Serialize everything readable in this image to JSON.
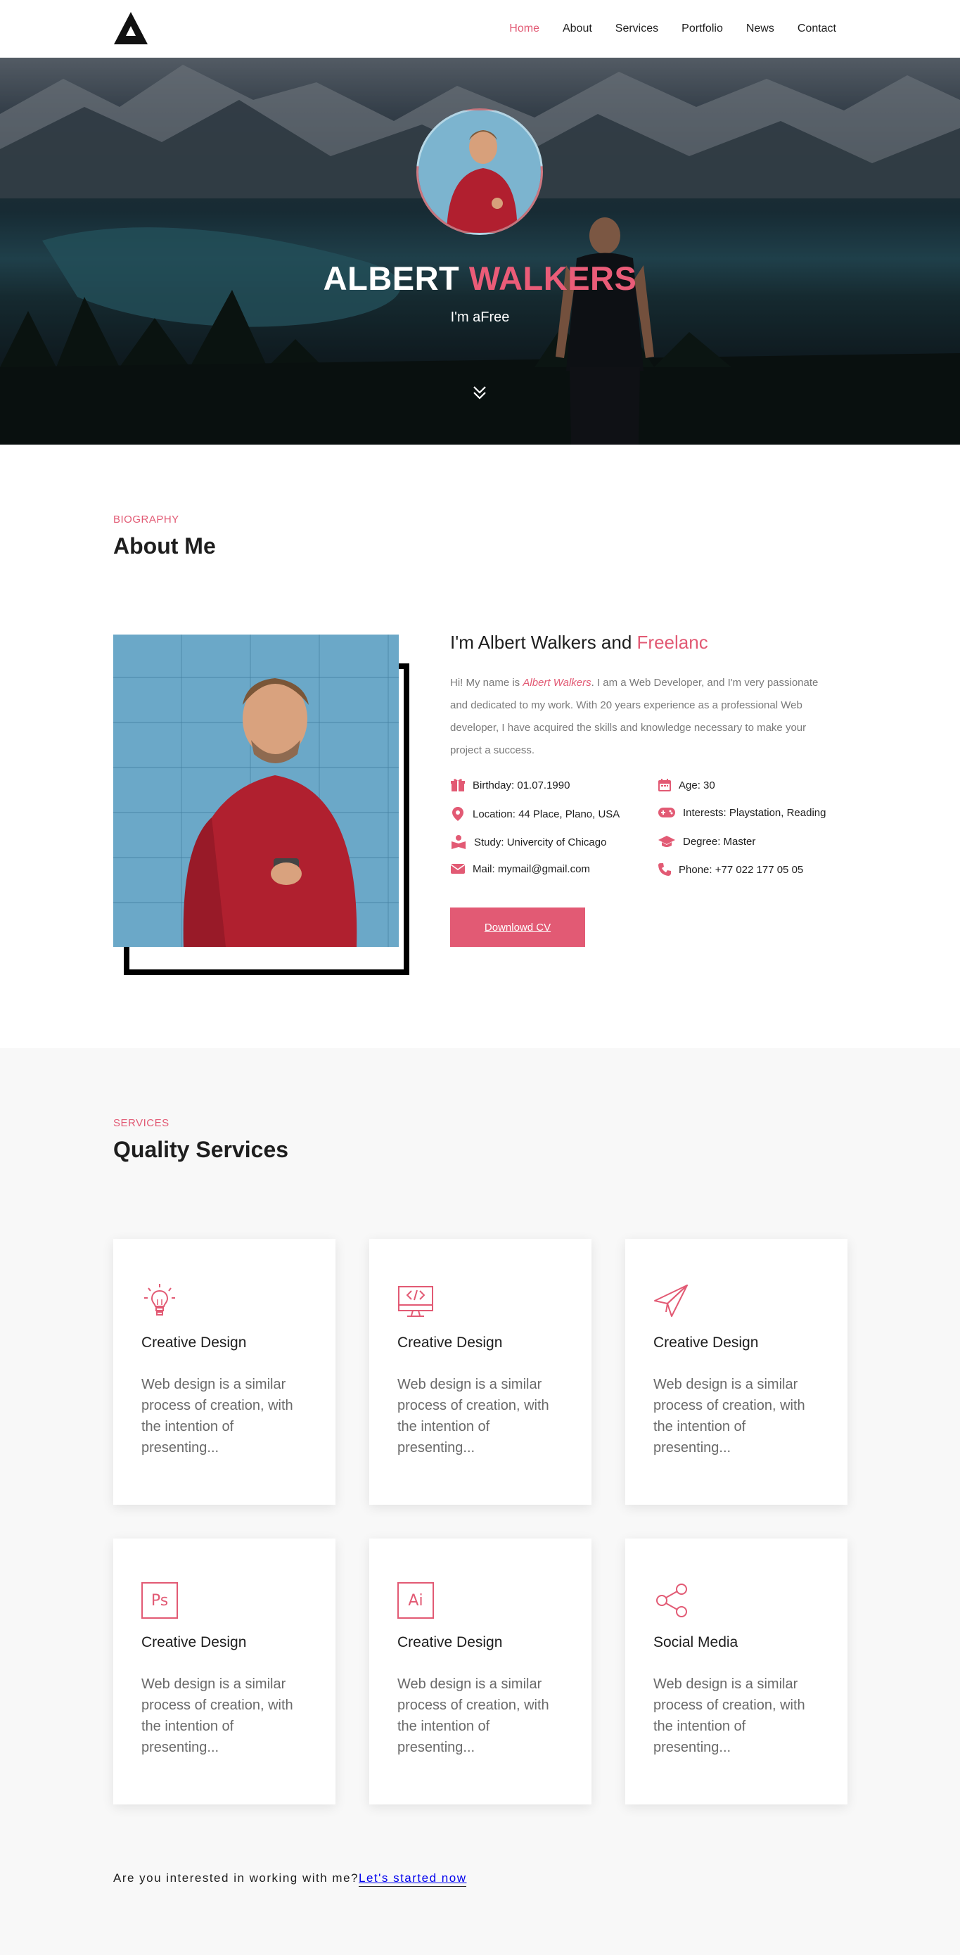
{
  "nav": {
    "logo_icon": "brand-triangle-logo",
    "items": [
      {
        "label": "Home",
        "active": true
      },
      {
        "label": "About",
        "active": false
      },
      {
        "label": "Services",
        "active": false
      },
      {
        "label": "Portfolio",
        "active": false
      },
      {
        "label": "News",
        "active": false
      },
      {
        "label": "Contact",
        "active": false
      }
    ]
  },
  "hero": {
    "first_name": "ALBERT",
    "last_name": "WALKERS",
    "subtitle": "I'm aFree",
    "scroll_icon": "double-chevron-down-icon"
  },
  "about": {
    "tag": "BIOGRAPHY",
    "title": "About Me",
    "headline_prefix": "I'm Albert Walkers and",
    "headline_highlight": "Freelanc",
    "intro_before": "Hi! My name is",
    "intro_name": "Albert Walkers",
    "intro_after": ". I am a Web Developer, and I'm very passionate and dedicated to my work. With 20 years experience as a professional Web developer, I have acquired the skills and knowledge necessary to make your project a success.",
    "info_left": [
      {
        "icon": "gift-icon",
        "label": "Birthday:",
        "value": "01.07.1990"
      },
      {
        "icon": "map-pin-icon",
        "label": "Location:",
        "value": "44 Place, Plano, USA"
      },
      {
        "icon": "book-reader-icon",
        "label": "Study:",
        "value": "Univercity of Chicago"
      },
      {
        "icon": "envelope-icon",
        "label": "Mail:",
        "value": "mymail@gmail.com"
      }
    ],
    "info_right": [
      {
        "icon": "calendar-icon",
        "label": "Age:",
        "value": "30"
      },
      {
        "icon": "gamepad-icon",
        "label": "Interests:",
        "value": "Playstation, Reading"
      },
      {
        "icon": "graduation-cap-icon",
        "label": "Degree:",
        "value": "Master"
      },
      {
        "icon": "phone-icon",
        "label": "Phone:",
        "value": "+77 022 177 05 05"
      }
    ],
    "cv_button": "Downlowd CV"
  },
  "services": {
    "tag": "SERVICES",
    "title": "Quality Services",
    "cards": [
      {
        "icon": "lightbulb-icon",
        "title": "Creative Design",
        "text": "Web design is a similar process of creation, with the intention of presenting..."
      },
      {
        "icon": "code-monitor-icon",
        "title": "Creative Design",
        "text": "Web design is a similar process of creation, with the intention of presenting..."
      },
      {
        "icon": "paper-plane-icon",
        "title": "Creative Design",
        "text": "Web design is a similar process of creation, with the intention of presenting..."
      },
      {
        "icon": "photoshop-icon",
        "icon_text": "Ps",
        "title": "Creative Design",
        "text": "Web design is a similar process of creation, with the intention of presenting..."
      },
      {
        "icon": "illustrator-icon",
        "icon_text": "Ai",
        "title": "Creative Design",
        "text": "Web design is a similar process of creation, with the intention of presenting..."
      },
      {
        "icon": "share-icon",
        "title": "Social Media",
        "text": "Web design is a similar process of creation, with the intention of presenting..."
      }
    ]
  },
  "cta": {
    "question": "Are you interested in working with me?",
    "link": "Let's started now"
  },
  "colors": {
    "accent": "#e25a74",
    "text": "#1e1e1e",
    "muted": "#7a7a7a",
    "section_bg": "#f8f8f8"
  }
}
